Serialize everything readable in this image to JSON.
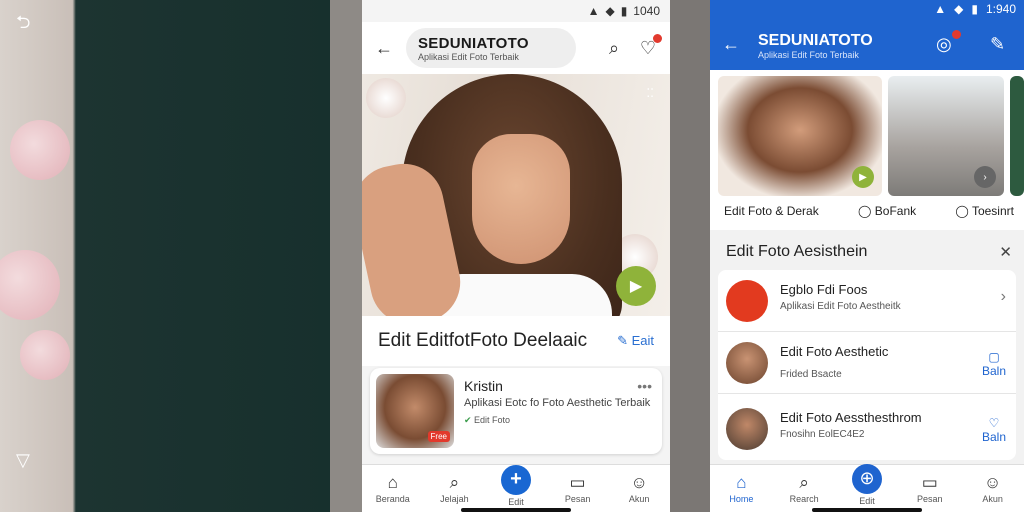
{
  "left_panel": {
    "top_icon": "back-arrow-icon",
    "bottom_icon": "triangle-icon"
  },
  "phone1": {
    "status": "1040",
    "header": {
      "brand": "SEDUNIATOTO",
      "subtitle": "Aplikasi Edit Foto Terbaik"
    },
    "hero": {
      "play_icon": "play-icon"
    },
    "title": "Edit EditfotFoto Deelaaic",
    "edit_link": "Eait",
    "card": {
      "name": "Kristin",
      "desc": "Aplikasi Eotc fo Foto Aesthetic Terbaik",
      "meta": "Edit Foto",
      "badge": "Free"
    },
    "nav": [
      {
        "label": "Beranda",
        "icon": "home-icon"
      },
      {
        "label": "Jelajah",
        "icon": "search-icon"
      },
      {
        "label": "Edit",
        "icon": "plus-icon"
      },
      {
        "label": "Pesan",
        "icon": "chat-icon"
      },
      {
        "label": "Akun",
        "icon": "profile-icon"
      }
    ]
  },
  "phone2": {
    "status": "1:940",
    "header": {
      "brand": "SEDUNIATOTO",
      "subtitle": "Aplikasi Edit Foto Terbaik"
    },
    "gallery_caps": [
      "Edit Foto & Derak",
      "BoFank",
      "Toesinrt"
    ],
    "section_title": "Edit Foto Aesisthein",
    "list": [
      {
        "title": "Egblo Fdi Foos",
        "sub": "Aplikasi Edit Foto Aestheitk",
        "right": "›"
      },
      {
        "title": "Edit Foto Aesthetic",
        "sub": "Frided Bsacte",
        "right": "Baln"
      },
      {
        "title": "Edit Foto Aessthesthrom",
        "sub": "Fnosihn EolEC4E2",
        "right": "Baln"
      }
    ],
    "nav": [
      {
        "label": "Home",
        "icon": "home-icon"
      },
      {
        "label": "Rearch",
        "icon": "search-icon"
      },
      {
        "label": "Edit",
        "icon": "plus-icon"
      },
      {
        "label": "Pesan",
        "icon": "chat-icon"
      },
      {
        "label": "Akun",
        "icon": "profile-icon"
      }
    ]
  }
}
